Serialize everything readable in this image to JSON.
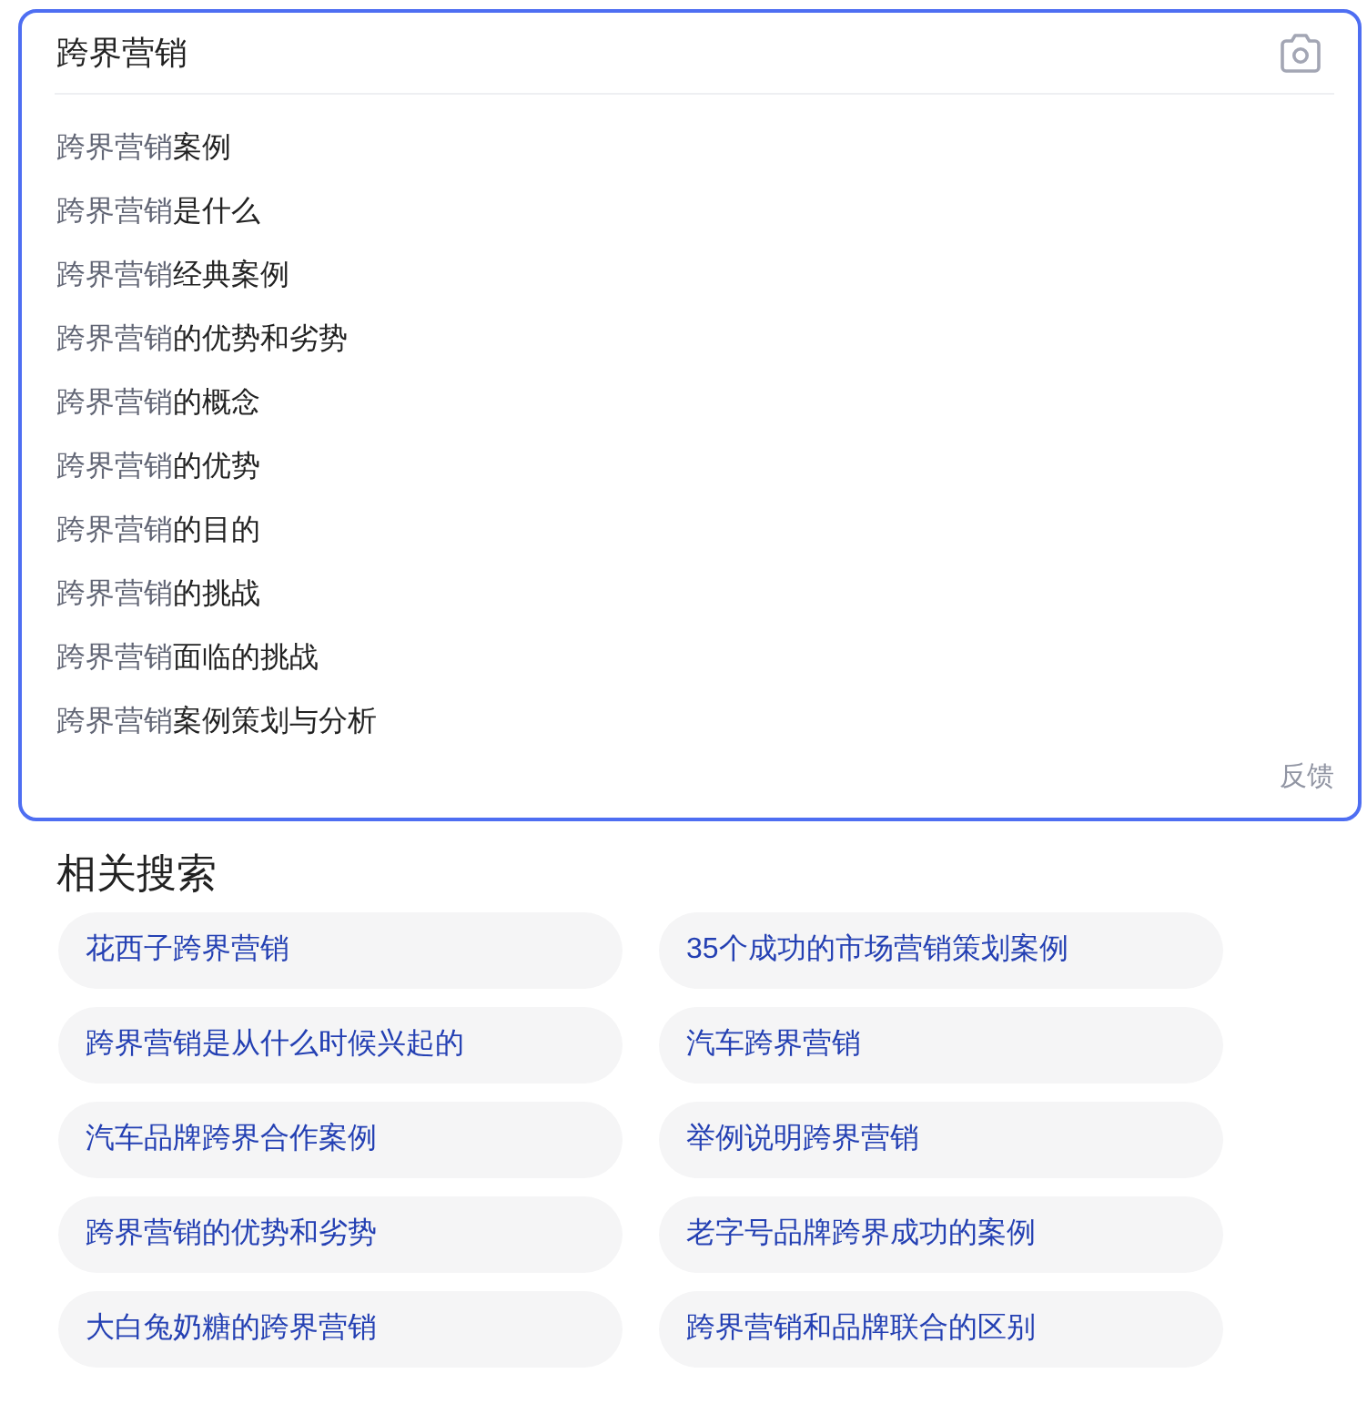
{
  "search": {
    "value": "跨界营销"
  },
  "suggestions": [
    {
      "match": "跨界营销",
      "rest": "案例"
    },
    {
      "match": "跨界营销",
      "rest": "是什么"
    },
    {
      "match": "跨界营销",
      "rest": "经典案例"
    },
    {
      "match": "跨界营销",
      "rest": "的优势和劣势"
    },
    {
      "match": "跨界营销",
      "rest": "的概念"
    },
    {
      "match": "跨界营销",
      "rest": "的优势"
    },
    {
      "match": "跨界营销",
      "rest": "的目的"
    },
    {
      "match": "跨界营销",
      "rest": "的挑战"
    },
    {
      "match": "跨界营销",
      "rest": "面临的挑战"
    },
    {
      "match": "跨界营销",
      "rest": "案例策划与分析"
    }
  ],
  "feedback_link": "反馈",
  "related_searches": {
    "title": "相关搜索",
    "items": [
      "花西子跨界营销",
      "35个成功的市场营销策划案例",
      "跨界营销是从什么时候兴起的",
      "汽车跨界营销",
      "汽车品牌跨界合作案例",
      "举例说明跨界营销",
      "跨界营销的优势和劣势",
      "老字号品牌跨界成功的案例",
      "大白兔奶糖的跨界营销",
      "跨界营销和品牌联合的区别"
    ]
  }
}
